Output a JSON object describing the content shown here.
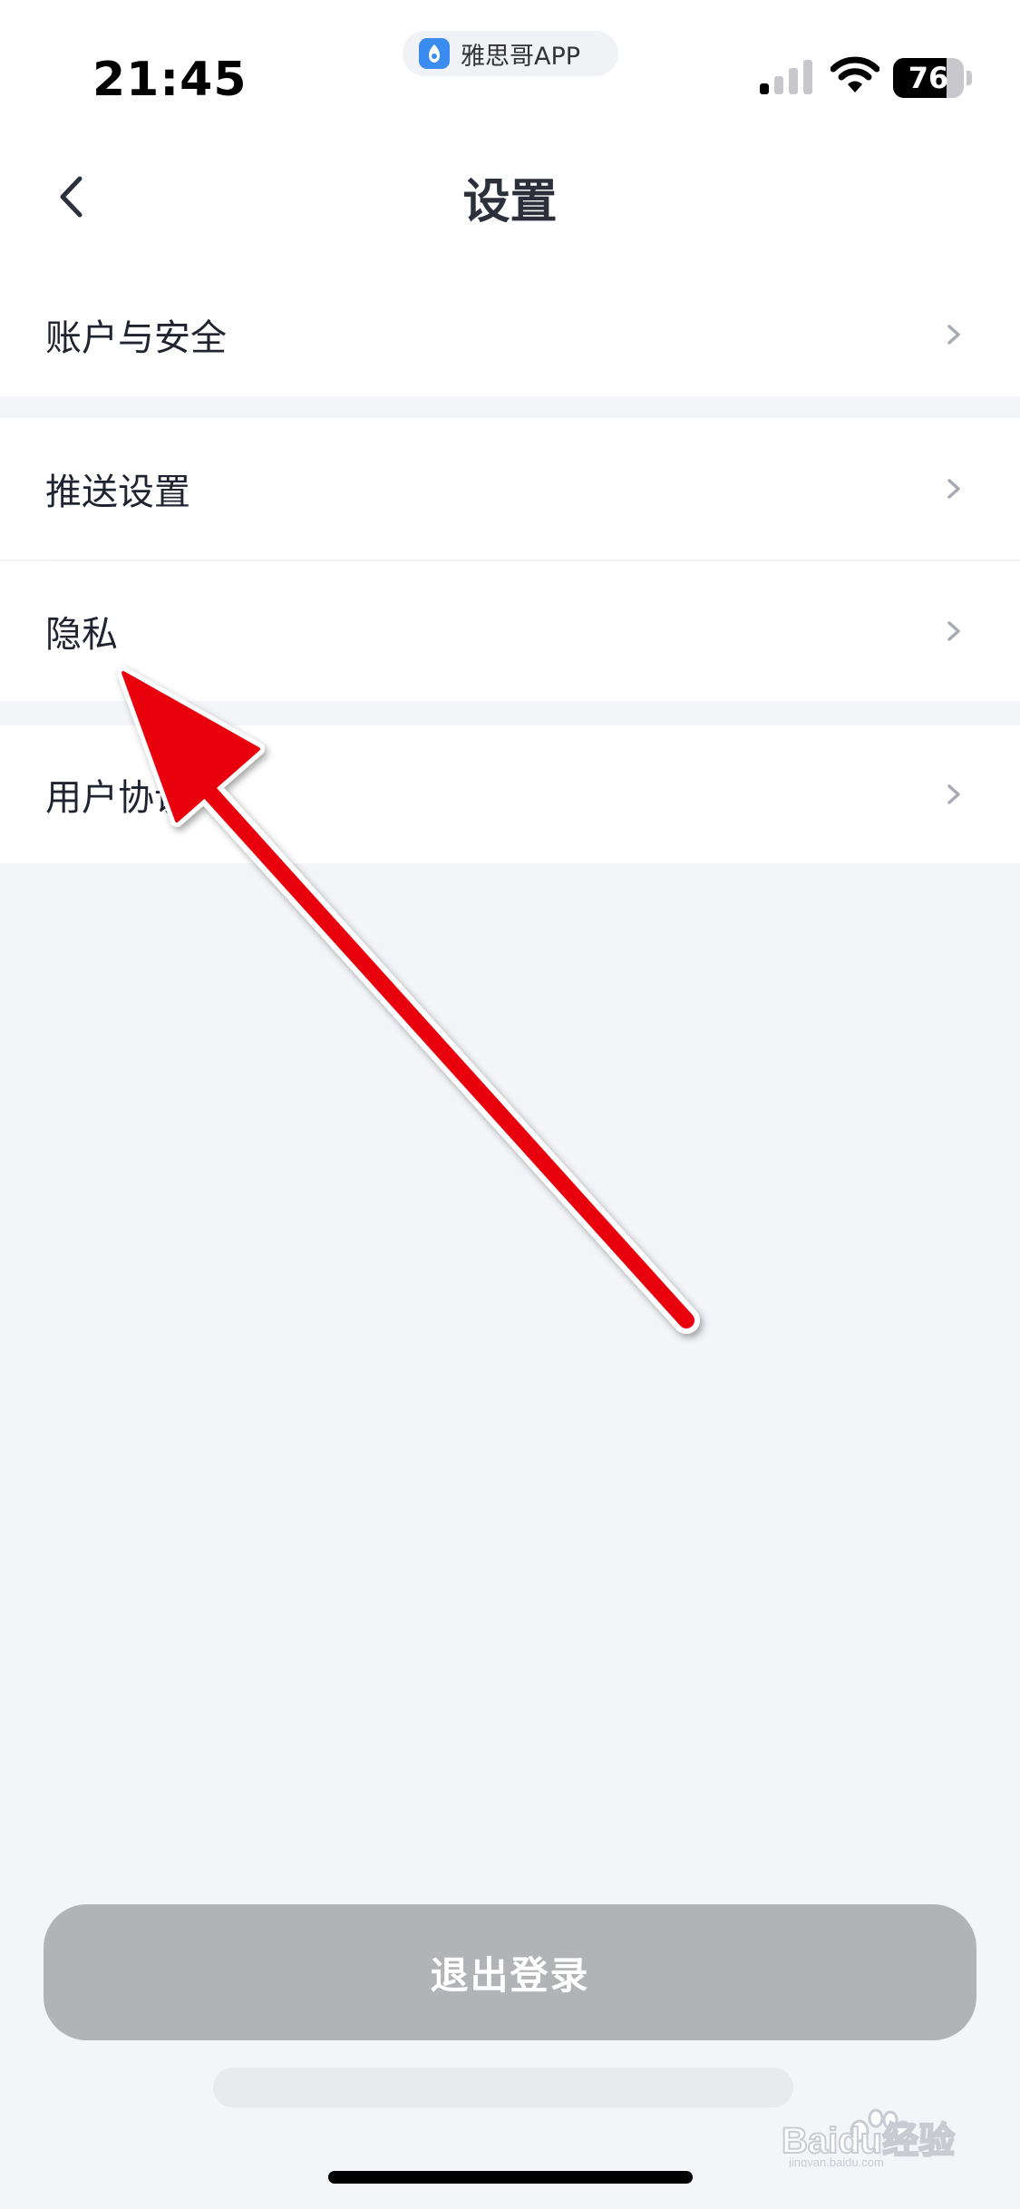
{
  "status_bar": {
    "time": "21:45",
    "app_pill_label": "雅思哥APP",
    "battery_level": "76",
    "battery_fraction": 0.76
  },
  "nav": {
    "title": "设置",
    "back_icon": "chevron-left-icon"
  },
  "settings": {
    "items": [
      {
        "label": "账户与安全"
      },
      {
        "label": "推送设置"
      },
      {
        "label": "隐私"
      },
      {
        "label": "用户协议"
      }
    ]
  },
  "logout": {
    "label": "退出登录"
  },
  "watermark": {
    "text": "Baidu经验",
    "subtext": "jingyan.baidu.com"
  },
  "colors": {
    "background": "#f4f5f9",
    "row": "#ffffff",
    "logout_button": "#b2b3b7",
    "annotation_arrow": "#e8000b"
  }
}
